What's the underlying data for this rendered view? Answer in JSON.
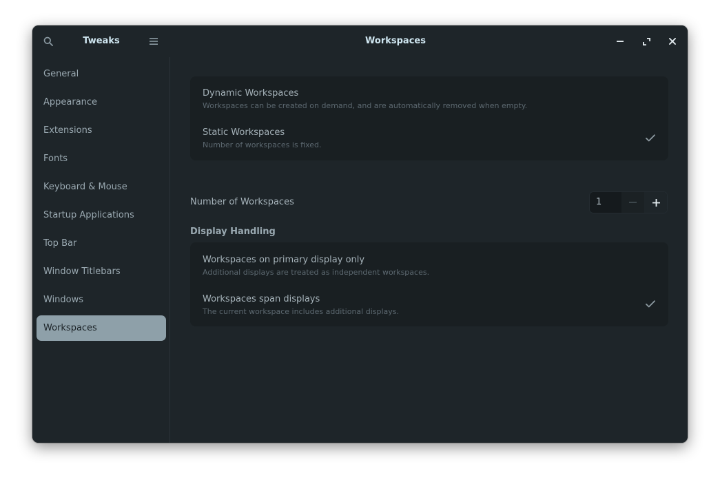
{
  "app": {
    "name": "Tweaks",
    "page_title": "Workspaces"
  },
  "headerbar": {
    "search_icon": "search-icon",
    "menu_icon": "hamburger-menu-icon",
    "window_controls": [
      "minimize-icon",
      "maximize-icon",
      "close-icon"
    ]
  },
  "sidebar": {
    "selected": "Workspaces",
    "items": [
      {
        "label": "General"
      },
      {
        "label": "Appearance"
      },
      {
        "label": "Extensions"
      },
      {
        "label": "Fonts"
      },
      {
        "label": "Keyboard & Mouse"
      },
      {
        "label": "Startup Applications"
      },
      {
        "label": "Top Bar"
      },
      {
        "label": "Window Titlebars"
      },
      {
        "label": "Windows"
      },
      {
        "label": "Workspaces"
      }
    ]
  },
  "workspace_mode": {
    "selected": "Static Workspaces",
    "options": [
      {
        "title": "Dynamic Workspaces",
        "subtitle": "Workspaces can be created on demand, and are automatically removed when empty.",
        "checked": false
      },
      {
        "title": "Static Workspaces",
        "subtitle": "Number of workspaces is fixed.",
        "checked": true
      }
    ]
  },
  "number_of_workspaces": {
    "label": "Number of Workspaces",
    "value": "1",
    "minus": "−",
    "plus": "+"
  },
  "display_handling": {
    "heading": "Display Handling",
    "selected": "Workspaces span displays",
    "options": [
      {
        "title": "Workspaces on primary display only",
        "subtitle": "Additional displays are treated as independent workspaces.",
        "checked": false
      },
      {
        "title": "Workspaces span displays",
        "subtitle": "The current workspace includes additional displays.",
        "checked": true
      }
    ]
  },
  "colors": {
    "window_bg": "#1e2529",
    "card_bg": "#191f22",
    "selected_item_bg": "#8ea0a9",
    "title_text": "#cfe6f0",
    "primary_text": "#a5b2b9",
    "secondary_text": "#5c6870"
  }
}
